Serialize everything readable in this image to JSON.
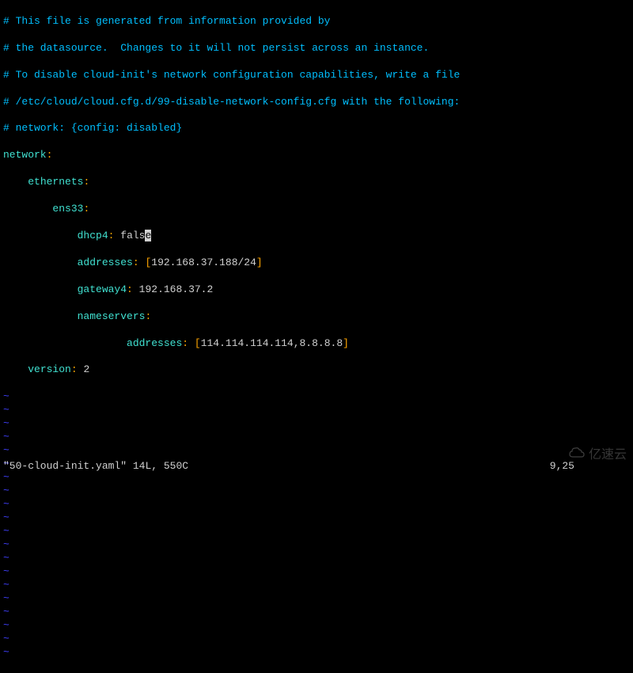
{
  "comments": [
    "# This file is generated from information provided by",
    "# the datasource.  Changes to it will not persist across an instance.",
    "# To disable cloud-init's network configuration capabilities, write a file",
    "# /etc/cloud/cloud.cfg.d/99-disable-network-config.cfg with the following:",
    "# network: {config: disabled}"
  ],
  "yaml": {
    "network_key": "network",
    "ethernets_key": "ethernets",
    "interface_key": "ens33",
    "dhcp4_key": "dhcp4",
    "dhcp4_value": "false",
    "addresses_key": "addresses",
    "addresses_value": "192.168.37.188/24",
    "gateway4_key": "gateway4",
    "gateway4_value": "192.168.37.2",
    "nameservers_key": "nameservers",
    "ns_addresses_key": "addresses",
    "ns_addresses_value": "114.114.114.114,8.8.8.8",
    "version_key": "version",
    "version_value": "2"
  },
  "tilde": "~",
  "tilde_count": 20,
  "status": {
    "filename": "\"50-cloud-init.yaml\"",
    "info": "14L, 550C",
    "position": "9,25"
  },
  "watermark": {
    "text": "亿速云"
  }
}
